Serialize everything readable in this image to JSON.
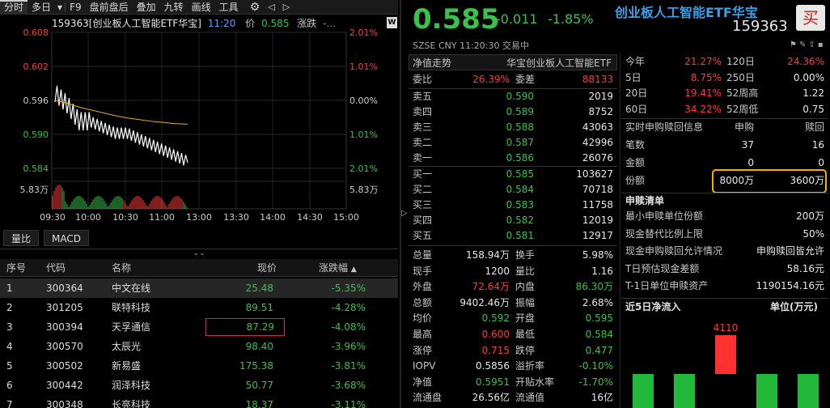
{
  "toolbar": {
    "items": [
      "分时",
      "多日",
      "▾",
      "F9",
      "盘前盘后",
      "叠加",
      "九转",
      "画线",
      "工具"
    ],
    "wd_label": "W"
  },
  "chart": {
    "code_name": "159363[创业板人工智能ETF华宝]",
    "time": "11:20",
    "price_label": "价",
    "price": "0.585",
    "change_label": "涨跌",
    "change": "-...",
    "y_left": [
      "0.608",
      "0.602",
      "0.596",
      "0.590",
      "0.584"
    ],
    "y_right": [
      "2.01%",
      "1.01%",
      "0.00%",
      "1.01%",
      "2.01%"
    ],
    "vol_left": "5.83万",
    "vol_right": "5.83万",
    "x_labels": [
      "09:30",
      "10:00",
      "10:30",
      "11:00",
      "13:00",
      "13:30",
      "14:00",
      "14:30",
      "15:00"
    ]
  },
  "chart_data": {
    "type": "line",
    "title": "159363[创业板人工智能ETF华宝]",
    "x": [
      "09:30",
      "09:40",
      "09:50",
      "10:00",
      "10:10",
      "10:20",
      "10:30",
      "10:40",
      "10:50",
      "11:00",
      "11:10",
      "11:20"
    ],
    "series": [
      {
        "name": "价",
        "values": [
          0.597,
          0.595,
          0.592,
          0.592,
          0.591,
          0.59,
          0.59,
          0.589,
          0.588,
          0.587,
          0.586,
          0.585
        ]
      },
      {
        "name": "均价",
        "values": [
          0.596,
          0.5955,
          0.5948,
          0.5943,
          0.5938,
          0.5933,
          0.5929,
          0.5926,
          0.5923,
          0.5921,
          0.5919,
          0.5918
        ]
      }
    ],
    "ylim": [
      0.584,
      0.608
    ]
  },
  "subtabs": [
    "量比",
    "MACD"
  ],
  "table": {
    "headers": [
      "序号",
      "代码",
      "名称",
      "现价",
      "涨跌幅"
    ],
    "rows": [
      [
        "1",
        "300364",
        "中文在线",
        "25.48",
        "-5.35%"
      ],
      [
        "2",
        "301205",
        "联特科技",
        "89.51",
        "-4.28%"
      ],
      [
        "3",
        "300394",
        "天孚通信",
        "87.29",
        "-4.08%"
      ],
      [
        "4",
        "300570",
        "太辰光",
        "98.40",
        "-3.96%"
      ],
      [
        "5",
        "300502",
        "新易盛",
        "175.38",
        "-3.81%"
      ],
      [
        "6",
        "300442",
        "润泽科技",
        "50.77",
        "-3.68%"
      ],
      [
        "7",
        "300348",
        "长亮科技",
        "18.37",
        "-3.11%"
      ]
    ]
  },
  "quote": {
    "price": "0.585",
    "change": "-0.011",
    "pct": "-1.85%",
    "name": "创业板人工智能ETF华宝",
    "code": "159363",
    "exchange": "SZSE",
    "currency": "CNY",
    "time": "11:20:30",
    "status": "交易中",
    "buy_label": "买"
  },
  "book": {
    "tab1": "净值走势",
    "tab2": "华宝创业板人工智能ETF",
    "weibi_label": "委比",
    "weibi": "26.39%",
    "weicha_label": "委差",
    "weicha": "88133",
    "asks": [
      [
        "卖五",
        "0.590",
        "2019"
      ],
      [
        "卖四",
        "0.589",
        "8752"
      ],
      [
        "卖三",
        "0.588",
        "43063"
      ],
      [
        "卖二",
        "0.587",
        "42996"
      ],
      [
        "卖一",
        "0.586",
        "26076"
      ]
    ],
    "bids": [
      [
        "买一",
        "0.585",
        "103627"
      ],
      [
        "买二",
        "0.584",
        "70718"
      ],
      [
        "买三",
        "0.583",
        "11758"
      ],
      [
        "买四",
        "0.582",
        "12019"
      ],
      [
        "买五",
        "0.581",
        "12917"
      ]
    ]
  },
  "stats": [
    [
      "总量",
      "158.94万",
      "换手",
      "5.98%"
    ],
    [
      "现手",
      "1200",
      "量比",
      "1.16"
    ],
    [
      "外盘",
      "72.64万",
      "内盘",
      "86.30万"
    ],
    [
      "总额",
      "9402.46万",
      "振幅",
      "2.68%"
    ],
    [
      "均价",
      "0.592",
      "开盘",
      "0.595"
    ],
    [
      "最高",
      "0.600",
      "最低",
      "0.584"
    ],
    [
      "涨停",
      "0.715",
      "跌停",
      "0.477"
    ],
    [
      "IOPV",
      "0.5856",
      "溢折率",
      "-0.10%"
    ],
    [
      "净值",
      "0.5951",
      "开贴水率",
      "-1.70%"
    ],
    [
      "流通盘",
      "26.56亿",
      "流通值",
      "16亿"
    ]
  ],
  "perf": [
    [
      "今年",
      "21.27%",
      "120日",
      "24.36%"
    ],
    [
      "5日",
      "8.75%",
      "250日",
      "0.00%"
    ],
    [
      "20日",
      "19.41%",
      "52周高",
      "1.22"
    ],
    [
      "60日",
      "34.22%",
      "52周低",
      "0.75"
    ]
  ],
  "realtime": {
    "title": "实时申购赎回信息",
    "col1": "申购",
    "col2": "赎回",
    "rows": [
      [
        "笔数",
        "37",
        "16"
      ],
      [
        "金额",
        "0",
        "0"
      ],
      [
        "份额",
        "8000万",
        "3600万"
      ]
    ]
  },
  "shenshu": {
    "title": "申赎清单",
    "rows": [
      [
        "最小申赎单位份额",
        "200万"
      ],
      [
        "现金替代比例上限",
        "50%"
      ],
      [
        "现金申购赎回允许情况",
        "申购赎回皆允许"
      ],
      [
        "T日预估现金差额",
        "58.16元"
      ],
      [
        "T-1日单位申赎资产",
        "1190154.16元"
      ]
    ]
  },
  "flow": {
    "title": "近5日净流入",
    "unit": "单位(万元)",
    "peak_label": "4110",
    "values": [
      -2500,
      -2500,
      4110,
      -2500,
      -2500
    ]
  }
}
